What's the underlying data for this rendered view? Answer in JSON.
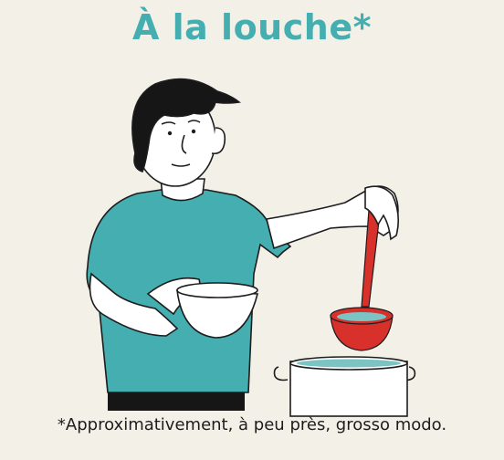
{
  "title": "À la louche*",
  "caption": "*Approximativement, à peu près, grosso modo.",
  "colors": {
    "background": "#f3f0e8",
    "title": "#45aeb0",
    "shirt": "#45aeb0",
    "ladle": "#d8312c",
    "hair": "#161616",
    "skin": "#ffffff",
    "liquid": "#7cc3c4"
  }
}
